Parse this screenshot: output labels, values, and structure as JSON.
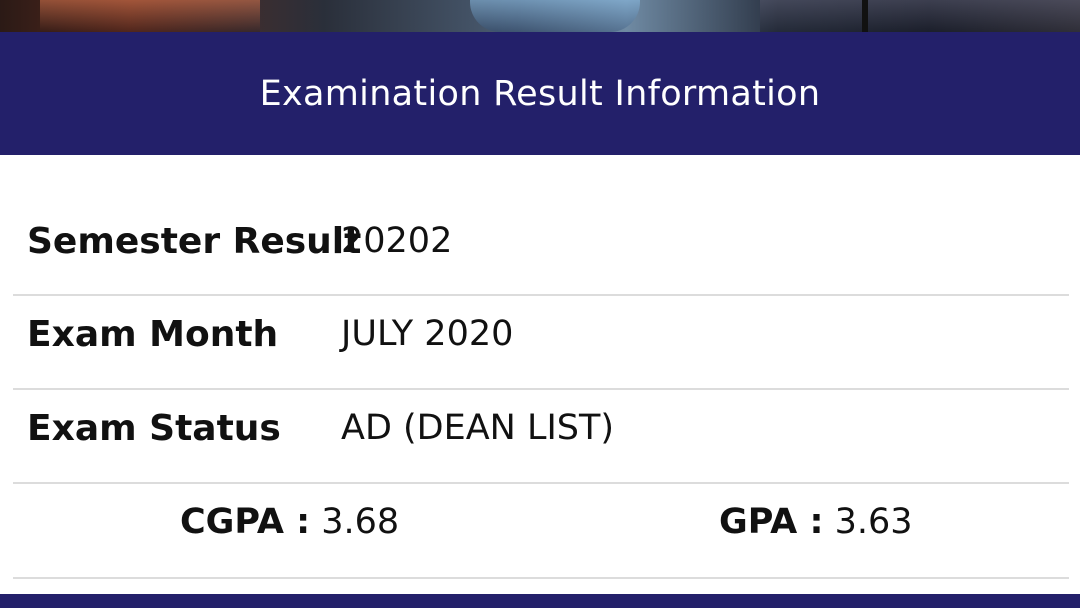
{
  "header": {
    "title": "Examination Result Information"
  },
  "rows": [
    {
      "label": "Semester Result",
      "value": "20202"
    },
    {
      "label": "Exam Month",
      "value": "JULY 2020"
    },
    {
      "label": "Exam Status",
      "value": "AD (DEAN LIST)"
    }
  ],
  "summary": {
    "cgpa_label": "CGPA :",
    "cgpa_value": "3.68",
    "gpa_label": "GPA :",
    "gpa_value": "3.63"
  },
  "colors": {
    "header_bg": "#23206a",
    "divider": "#dcdcdc"
  }
}
